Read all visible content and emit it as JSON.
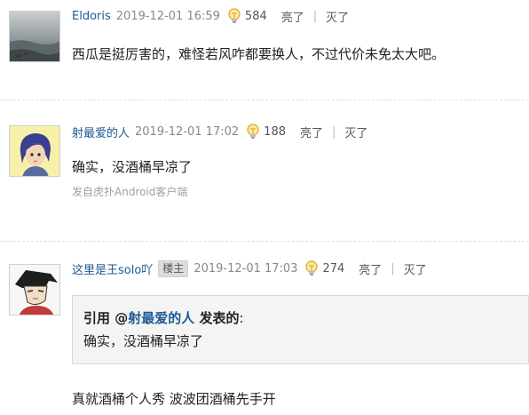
{
  "posts": [
    {
      "username": "Eldoris",
      "time": "2019-12-01 16:59",
      "light_count": "584",
      "light_label": "亮了",
      "out_label": "灭了",
      "separator": "|",
      "content": "西瓜是挺厉害的，难怪若风咋都要换人，不过代价未免太大吧。"
    },
    {
      "username": "射最爱的人",
      "time": "2019-12-01 17:02",
      "light_count": "188",
      "light_label": "亮了",
      "out_label": "灭了",
      "separator": "|",
      "content": "确实，没酒桶早凉了",
      "source": "发自虎扑Android客户端"
    },
    {
      "username": "这里是王solo吖",
      "badge": "楼主",
      "time": "2019-12-01 17:03",
      "light_count": "274",
      "light_label": "亮了",
      "out_label": "灭了",
      "separator": "|",
      "quote": {
        "prefix": "引用 @",
        "author": "射最爱的人",
        "suffix": " 发表的",
        "colon": ":",
        "body": "确实，没酒桶早凉了"
      },
      "content": "真就酒桶个人秀 波波团酒桶先手开"
    }
  ],
  "colors": {
    "username": "#1d5a94",
    "meta": "#888888",
    "bulb": "#f2b01e"
  }
}
